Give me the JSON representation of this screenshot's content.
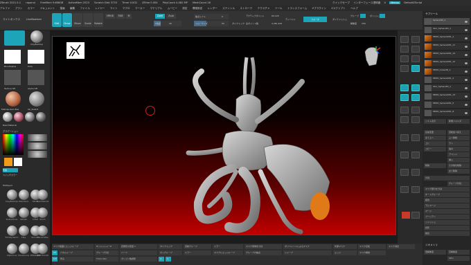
{
  "titlebar": {
    "items": [
      "ZBrush 2021.5.1",
      "rapanui",
      "FreeMem 9.686GB",
      "ActiveMem 2523",
      "Scratch Disk 3733",
      "Timer 0.002",
      "ATime 0.004",
      "PolyCount 4.482 MP",
      "MeshCount 28"
    ],
    "right": [
      "クイックセーブ",
      "インターフェース透明度",
      "0",
      "Menus",
      "DefaultZScript"
    ]
  },
  "menubar": {
    "items": [
      "アルファ",
      "ブラシ",
      "カラー",
      "ドキュメント",
      "描画",
      "編集",
      "ファイル",
      "レイヤー",
      "ライト",
      "マクロ",
      "マーカー",
      "マテリアル",
      "ムービー",
      "設定",
      "環境設定",
      "レンダー",
      "ステンシル",
      "ストローク",
      "テクスチャ",
      "ツール",
      "トランスフォーム",
      "Zプラグイン",
      "Zスクリプト",
      "ヘルプ"
    ]
  },
  "toolbar": {
    "lightbox": "ライトボックス",
    "livebooleans": "LiveBoolean",
    "edit": "Edit",
    "draw": "Draw",
    "move": "Move",
    "scale": "Scale",
    "rotate": "Rotate",
    "mrgb": "MRGB",
    "rgb": "RGB",
    "m": "M",
    "zadd": "Zadd",
    "zsub": "Zsub",
    "zadd_value": "Zadd",
    "z_intensity_label": "Z強度",
    "z_intensity_value": "26",
    "focal_shift_label": "焦点シフト",
    "focal_shift_value": "0",
    "draw_size_label": "ドローサイズ",
    "draw_size_value": "55",
    "dynamic": "ダイナミック",
    "active_points_label": "アクティブポイント",
    "active_points_value": "80,128",
    "total_points_label": "全ポイント数",
    "total_points_value": "4,481,400",
    "dividebutton": "ディバイド",
    "smooth_label": "スムーズ",
    "dynamesh": "ダイナメッシュ",
    "group": "グループ",
    "polish": "ポリッシュ",
    "resolution": "解像度",
    "resolution_value": "256"
  },
  "lefttray": {
    "brushes": [
      "ClayBuildup",
      "Standard",
      "Move",
      "DamStandard",
      "SnakeHook",
      "hPolish",
      "Inflat",
      "Pinch",
      "TrimDynamic",
      "Clay",
      "Smooth",
      "CurveTube",
      "ClipCurve",
      "SliceCurve",
      "ZModeler",
      "IMM Primitives"
    ],
    "top_labels": [
      "ClayBuildup",
      "BrushAlpha",
      "Texture Off",
      "MatCap Red Wax",
      "SK_Slash3",
      "BasicMaterial",
      "Dots",
      "Alpha Off"
    ],
    "color_label": "グラデーション",
    "switch_color": "スイッチカラー",
    "alternate": "代替",
    "fill_object": "FillObject"
  },
  "rightpanel": {
    "header": "サブツール",
    "subtools": [
      {
        "name": "Sphere3D_1",
        "orange": false
      },
      {
        "name": "Skin_Sphere3D_1",
        "orange": false
      },
      {
        "name": "PM3D_Sphere3D1_1",
        "orange": true
      },
      {
        "name": "PM3D_Sphere3D1_11",
        "orange": true
      },
      {
        "name": "PM3D_Sphere3D1_14",
        "orange": true
      },
      {
        "name": "PM3D_Sphere3D1_12",
        "orange": true
      },
      {
        "name": "PM3D_Cube3D_1",
        "orange": true
      },
      {
        "name": "PM3D_Sphere3D1_2",
        "orange": false
      },
      {
        "name": "Skin_Sphere3D_1",
        "orange": false
      },
      {
        "name": "PM3D_Sphere3D1_13",
        "orange": false
      },
      {
        "name": "PM3D_Sphere3D1_5",
        "orange": false
      },
      {
        "name": "PM3D_Sphere3D1_8",
        "orange": false
      }
    ],
    "list_all": "リスト表示",
    "new_folder": "新規フォルダ",
    "buttons": [
      "名前変更",
      "自動並べ替え",
      "全て上へ",
      "上へ移動",
      "上に",
      "下へ",
      "コピー",
      "貼付",
      "アペンド",
      "挿入",
      "削除",
      "その他を削除",
      "全て削除",
      "分割",
      "グループ分割",
      "マスク部分を分割",
      "オートグループ",
      "結合",
      "下にマージ",
      "マージ",
      "ブーリアン",
      "リメッシュ",
      "投影",
      "抽出"
    ],
    "geometry_header": "ジオメトリ",
    "lower_res": "低解像度",
    "higher_res": "高解像度",
    "sdiv": "SDiv"
  },
  "rightshelf": {
    "labels": [
      "BPR",
      "SPix 3",
      "ダイナミック",
      "実寸",
      "AAHalf",
      "パース",
      "フロア",
      "ローカル",
      "L.Sym",
      "XYZ",
      "移動",
      "拡大縮小",
      "回転",
      "ライン塗り",
      "透明",
      "Ghost",
      "ソロ"
    ]
  },
  "bottombar": {
    "cells": [
      "マスク範囲にエッジループ",
      "ZリメッシャーZ",
      "四角形の密度 1",
      "ダイナミック",
      "自動グループ",
      "ミラー",
      "マスク領域を分割",
      "ポリペイントによるマスク",
      "外部マスク",
      "マスク反転",
      "マスク消去",
      "パネルループ",
      "グループ分割",
      "ハーフ",
      "ポリグループ",
      "ミラー",
      "マスクにエッジループ",
      "グループの抽出",
      "シャープ",
      "エッジ",
      "マスク解除",
      "厚み",
      "Thick Skin",
      "ポリゴン数調整"
    ],
    "values": [
      "12",
      "0.5",
      "4",
      "1"
    ]
  }
}
